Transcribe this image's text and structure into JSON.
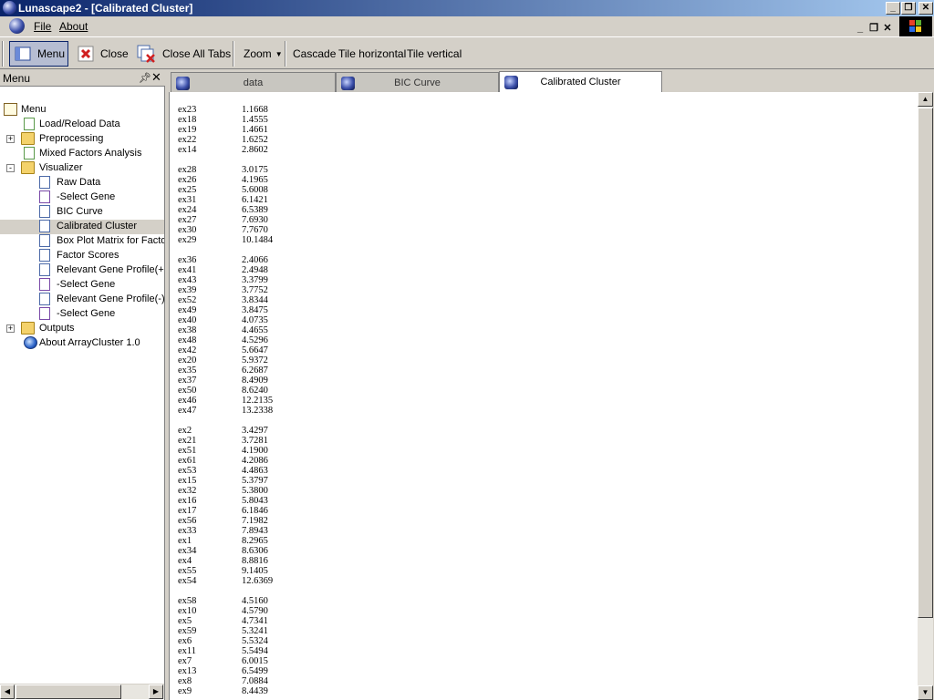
{
  "window": {
    "title": "Lunascape2 - [Calibrated Cluster]"
  },
  "menubar": {
    "file_label": "File",
    "about_label": "About"
  },
  "toolbar": {
    "menu_label": "Menu",
    "close_label": "Close",
    "close_all_label": "Close All Tabs",
    "zoom_label": "Zoom",
    "cascade_label": "Cascade",
    "tile_h_label": "Tile horizontal",
    "tile_v_label": "Tile vertical"
  },
  "panel": {
    "title": "Menu"
  },
  "tree": [
    {
      "label": "Menu",
      "icon": "menu-icon",
      "expander": "",
      "selected": false
    },
    {
      "label": "Load/Reload Data",
      "icon": "green-page-icon",
      "expander": "",
      "selected": false
    },
    {
      "label": "Preprocessing",
      "icon": "folder-icon",
      "expander": "+",
      "selected": false
    },
    {
      "label": "Mixed Factors Analysis",
      "icon": "green-page-icon",
      "expander": "",
      "selected": false
    },
    {
      "label": "Visualizer",
      "icon": "folder-icon",
      "expander": "-",
      "selected": false
    },
    {
      "label": "Raw Data",
      "icon": "page-icon",
      "expander": "",
      "selected": false
    },
    {
      "label": "-Select Gene",
      "icon": "purple-page-icon",
      "expander": "",
      "selected": false
    },
    {
      "label": "BIC Curve",
      "icon": "page-icon",
      "expander": "",
      "selected": false
    },
    {
      "label": "Calibrated Cluster",
      "icon": "page-icon",
      "expander": "",
      "selected": true
    },
    {
      "label": "Box Plot Matrix for Facto",
      "icon": "page-icon",
      "expander": "",
      "selected": false
    },
    {
      "label": "Factor Scores",
      "icon": "page-icon",
      "expander": "",
      "selected": false
    },
    {
      "label": "Relevant Gene Profile(+",
      "icon": "page-icon",
      "expander": "",
      "selected": false
    },
    {
      "label": "-Select Gene",
      "icon": "purple-page-icon",
      "expander": "",
      "selected": false
    },
    {
      "label": "Relevant Gene Profile(-)",
      "icon": "page-icon",
      "expander": "",
      "selected": false
    },
    {
      "label": "-Select Gene",
      "icon": "purple-page-icon",
      "expander": "",
      "selected": false
    },
    {
      "label": "Outputs",
      "icon": "folder-icon",
      "expander": "+",
      "selected": false
    },
    {
      "label": "About ArrayCluster 1.0",
      "icon": "globe-icon",
      "expander": "",
      "selected": false
    }
  ],
  "tabs": [
    {
      "label": "data",
      "active": false
    },
    {
      "label": "BIC Curve",
      "active": false
    },
    {
      "label": "Calibrated Cluster",
      "active": true
    }
  ],
  "clusters": [
    [
      [
        "ex23",
        "1.1668"
      ],
      [
        "ex18",
        "1.4555"
      ],
      [
        "ex19",
        "1.4661"
      ],
      [
        "ex22",
        "1.6252"
      ],
      [
        "ex14",
        "2.8602"
      ]
    ],
    [
      [
        "ex28",
        "3.0175"
      ],
      [
        "ex26",
        "4.1965"
      ],
      [
        "ex25",
        "5.6008"
      ],
      [
        "ex31",
        "6.1421"
      ],
      [
        "ex24",
        "6.5389"
      ],
      [
        "ex27",
        "7.6930"
      ],
      [
        "ex30",
        "7.7670"
      ],
      [
        "ex29",
        "10.1484"
      ]
    ],
    [
      [
        "ex36",
        "2.4066"
      ],
      [
        "ex41",
        "2.4948"
      ],
      [
        "ex43",
        "3.3799"
      ],
      [
        "ex39",
        "3.7752"
      ],
      [
        "ex52",
        "3.8344"
      ],
      [
        "ex49",
        "3.8475"
      ],
      [
        "ex40",
        "4.0735"
      ],
      [
        "ex38",
        "4.4655"
      ],
      [
        "ex48",
        "4.5296"
      ],
      [
        "ex42",
        "5.6647"
      ],
      [
        "ex20",
        "5.9372"
      ],
      [
        "ex35",
        "6.2687"
      ],
      [
        "ex37",
        "8.4909"
      ],
      [
        "ex50",
        "8.6240"
      ],
      [
        "ex46",
        "12.2135"
      ],
      [
        "ex47",
        "13.2338"
      ]
    ],
    [
      [
        "ex2",
        "3.4297"
      ],
      [
        "ex21",
        "3.7281"
      ],
      [
        "ex51",
        "4.1900"
      ],
      [
        "ex61",
        "4.2086"
      ],
      [
        "ex53",
        "4.4863"
      ],
      [
        "ex15",
        "5.3797"
      ],
      [
        "ex32",
        "5.3800"
      ],
      [
        "ex16",
        "5.8043"
      ],
      [
        "ex17",
        "6.1846"
      ],
      [
        "ex56",
        "7.1982"
      ],
      [
        "ex33",
        "7.8943"
      ],
      [
        "ex1",
        "8.2965"
      ],
      [
        "ex34",
        "8.6306"
      ],
      [
        "ex4",
        "8.8816"
      ],
      [
        "ex55",
        "9.1405"
      ],
      [
        "ex54",
        "12.6369"
      ]
    ],
    [
      [
        "ex58",
        "4.5160"
      ],
      [
        "ex10",
        "4.5790"
      ],
      [
        "ex5",
        "4.7341"
      ],
      [
        "ex59",
        "5.3241"
      ],
      [
        "ex6",
        "5.5324"
      ],
      [
        "ex11",
        "5.5494"
      ],
      [
        "ex7",
        "6.0015"
      ],
      [
        "ex13",
        "6.5499"
      ],
      [
        "ex8",
        "7.0884"
      ],
      [
        "ex9",
        "8.4439"
      ]
    ]
  ]
}
